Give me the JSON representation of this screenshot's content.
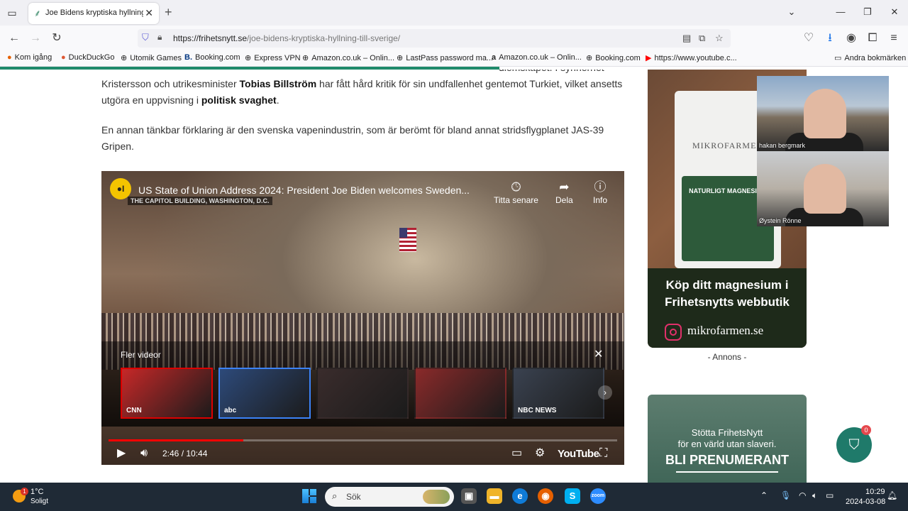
{
  "browser": {
    "tab_title": "Joe Bidens kryptiska hyllning till Sverige",
    "url_domain": "https://frihetsnytt.se",
    "url_path": "/joe-bidens-kryptiska-hyllning-till-sverige/",
    "bookmarks": [
      "Kom igång",
      "DuckDuckGo",
      "Utomik Games",
      "Booking.com",
      "Express VPN",
      "Amazon.co.uk – Onlin...",
      "LastPass password ma...",
      "Amazon.co.uk – Onlin...",
      "Booking.com",
      "https://www.youtube.c..."
    ],
    "other_bookmarks": "Andra bokmärken",
    "accent_color": "#1f8a6b"
  },
  "article": {
    "para1_fragment": "diemskapet. I synnerhet",
    "para1_line2_a": "Kristersson och utrikesminister ",
    "para1_line2_b": "Tobias Billström",
    "para1_line2_c": " har fått hård kritik för sin undfallenhet gentemot Turkiet, vilket ansetts",
    "para1_line3_a": "utgöra en uppvisning i ",
    "para1_line3_b": "politisk svaghet",
    "para1_line3_c": ".",
    "para2": "En annan tänkbar förklaring är den svenska vapenindustrin, som är berömt för bland annat stridsflygplanet JAS-39 Gripen."
  },
  "video": {
    "title": "US State of Union Address 2024: President Joe Biden welcomes Sweden...",
    "caption": "THE CAPITOL BUILDING, WASHINGTON, D.C.",
    "watch_later": "Titta senare",
    "share": "Dela",
    "info": "Info",
    "more_videos": "Fler videor",
    "time_current": "2:46",
    "time_total": "10:44",
    "progress_fraction": 0.265,
    "logo": "YouTube",
    "thumbnails": [
      {
        "label": "CNN",
        "color": "#c62828",
        "border": "#d00"
      },
      {
        "label": "abc",
        "color": "#2d4a7a",
        "border": "#3b82f6"
      },
      {
        "label": "",
        "color": "#3a2c2c",
        "border": "transparent"
      },
      {
        "label": "",
        "color": "#8a2a2a",
        "border": "transparent"
      },
      {
        "label": "NBC NEWS",
        "color": "#3a4250",
        "border": "transparent"
      }
    ]
  },
  "sidebar": {
    "ad1_brand": "MIKROFARMEN",
    "ad1_product": "NATURLIGT MAGNESIUM",
    "ad1_headline": "Köp ditt magnesium i Frihetsnytts webbutik",
    "ad1_site": "mikrofarmen.se",
    "annons": "- Annons -",
    "ad2_line1": "Stötta FrihetsNytt",
    "ad2_line2": "för en värld utan slaveri.",
    "ad2_cta": "BLI PRENUMERANT",
    "cart_count": "0"
  },
  "webcams": {
    "person1": "hakan bergmark",
    "person2": "Øystein Rönne"
  },
  "taskbar": {
    "temp": "1°C",
    "weather": "Soligt",
    "weather_badge": "1",
    "search": "Sök",
    "time": "10:29",
    "date": "2024-03-08"
  }
}
